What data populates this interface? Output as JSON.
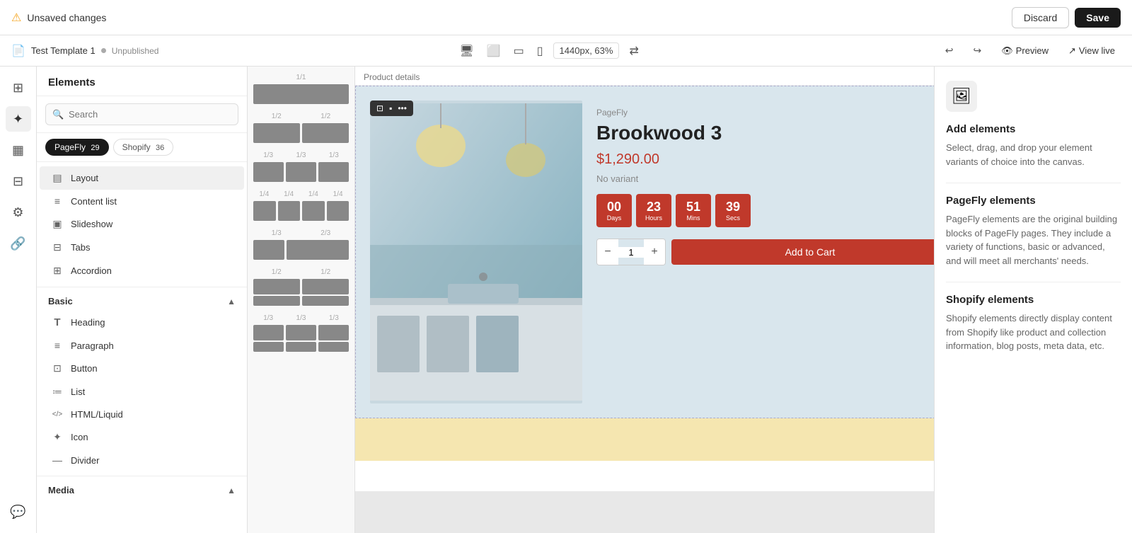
{
  "topbar": {
    "unsaved_label": "Unsaved changes",
    "discard_label": "Discard",
    "save_label": "Save"
  },
  "secondbar": {
    "template_name": "Test Template 1",
    "status": "Unpublished",
    "zoom_label": "1440px, 63%",
    "preview_label": "Preview",
    "viewlive_label": "View live"
  },
  "elements_panel": {
    "title": "Elements",
    "search_placeholder": "Search",
    "filters": [
      {
        "label": "PageFly",
        "count": "29",
        "active": true
      },
      {
        "label": "Shopify",
        "count": "36",
        "active": false
      }
    ],
    "layout_items": [
      {
        "label": "Layout",
        "active": true
      },
      {
        "label": "Content list"
      },
      {
        "label": "Slideshow"
      },
      {
        "label": "Tabs"
      },
      {
        "label": "Accordion"
      }
    ],
    "sections": [
      {
        "name": "Basic",
        "open": true,
        "items": [
          {
            "label": "Heading"
          },
          {
            "label": "Paragraph"
          },
          {
            "label": "Button"
          },
          {
            "label": "List"
          },
          {
            "label": "HTML/Liquid"
          },
          {
            "label": "Icon"
          },
          {
            "label": "Divider"
          }
        ]
      },
      {
        "name": "Media",
        "open": true,
        "items": []
      }
    ]
  },
  "layout_panel": {
    "layouts": [
      {
        "id": "1-1",
        "cols": [
          1
        ],
        "labels": [
          "1/1"
        ]
      },
      {
        "id": "1-2",
        "cols": [
          1,
          1
        ],
        "labels": [
          "1/2",
          "1/2"
        ]
      },
      {
        "id": "1-3",
        "cols": [
          1,
          1,
          1
        ],
        "labels": [
          "1/3",
          "1/3",
          "1/3"
        ]
      },
      {
        "id": "1-4",
        "cols": [
          1,
          1,
          1,
          1
        ],
        "labels": [
          "1/4",
          "1/4",
          "1/4",
          "1/4"
        ]
      },
      {
        "id": "1-3-2-3",
        "cols": [
          1,
          2
        ],
        "labels": [
          "1/3",
          "2/3"
        ]
      },
      {
        "id": "1-2b",
        "cols": [
          1,
          1
        ],
        "labels": [
          "1/2",
          "1/2"
        ]
      },
      {
        "id": "1-3c",
        "cols": [
          1,
          1,
          1
        ],
        "labels": [
          "1/3",
          "1/3",
          "1/3"
        ]
      }
    ]
  },
  "canvas": {
    "section_label": "Product details",
    "product": {
      "brand": "PageFly",
      "title": "Brookwood 3",
      "price": "$1,290.00",
      "variant": "No variant",
      "countdown": {
        "days": "00",
        "hours": "23",
        "mins": "51",
        "secs": "39",
        "days_label": "Days",
        "hours_label": "Hours",
        "mins_label": "Mins",
        "secs_label": "Secs"
      },
      "qty": "1",
      "add_to_cart": "Add to Cart"
    }
  },
  "right_panel": {
    "icon": "🖼",
    "add_elements_title": "Add elements",
    "add_elements_desc": "Select, drag, and drop your element variants of choice into the canvas.",
    "pagefly_elements_title": "PageFly elements",
    "pagefly_elements_desc": "PageFly elements are the original building blocks of PageFly pages. They include a variety of functions, basic or advanced, and will meet all merchants' needs.",
    "shopify_elements_title": "Shopify elements",
    "shopify_elements_desc": "Shopify elements directly display content from Shopify like product and collection information, blog posts, meta data, etc."
  },
  "icons": {
    "warning": "⚠",
    "template": "📄",
    "grid": "▦",
    "blocks": "⊞",
    "store": "🏬",
    "settings": "⚙",
    "link": "🔗",
    "chat": "💬",
    "layout_icon": "▤",
    "content_list_icon": "≡",
    "slideshow_icon": "▣",
    "tabs_icon": "⊟",
    "accordion_icon": "⊞",
    "heading_icon": "T",
    "paragraph_icon": "≡",
    "button_icon": "⊡",
    "list_icon": "≔",
    "html_icon": "</>",
    "icon_icon": "✦",
    "divider_icon": "—",
    "desktop_icon": "🖥",
    "laptop_icon": "💻",
    "tablet_icon": "📱",
    "mobile_icon": "📱",
    "swap_icon": "⇄",
    "undo_icon": "↩",
    "redo_icon": "↪",
    "eye_icon": "👁",
    "external_icon": "↗"
  }
}
